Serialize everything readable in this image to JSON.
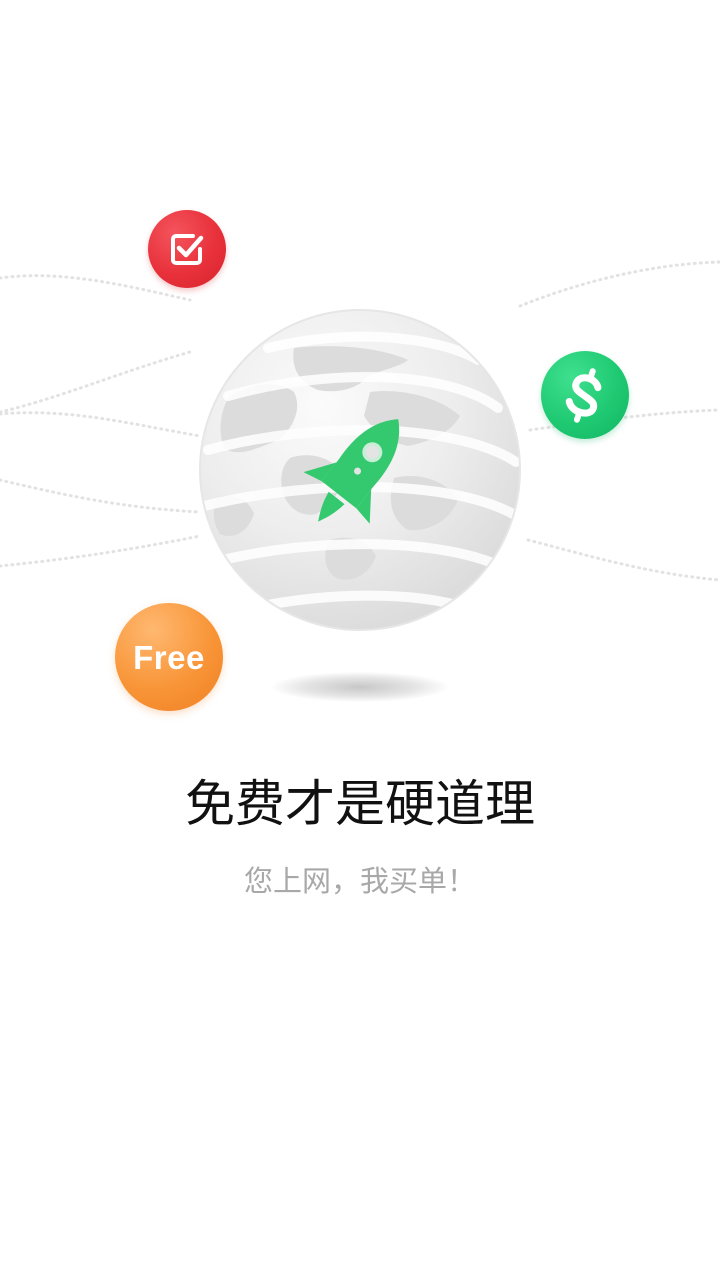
{
  "intro": {
    "title": "免费才是硬道理",
    "subtitle": "您上网，我买单！"
  },
  "badges": {
    "check": {
      "icon": "checkbox-icon",
      "color": "#e8313b"
    },
    "dollar": {
      "icon": "dollar-icon",
      "color": "#1fc972"
    },
    "free": {
      "label": "Free",
      "color": "#f89538"
    }
  },
  "globe": {
    "icon": "rocket-icon",
    "rocket_color": "#34c96e"
  }
}
